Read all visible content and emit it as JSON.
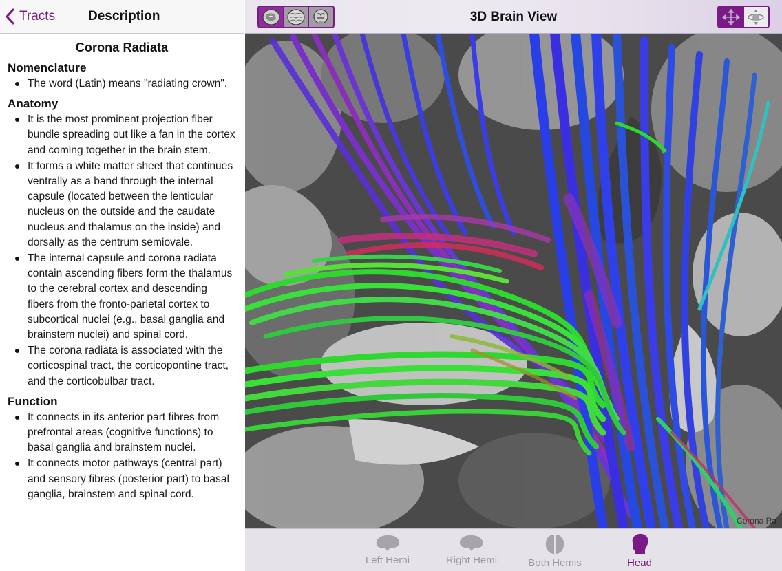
{
  "left_nav": {
    "back_label": "Tracts",
    "title": "Description"
  },
  "description": {
    "title": "Corona Radiata",
    "sections": [
      {
        "heading": "Nomenclature",
        "items": [
          "The word (Latin) means \"radiating crown\"."
        ]
      },
      {
        "heading": "Anatomy",
        "items": [
          "It is the most prominent projection fiber bundle spreading out like a fan in the cortex and coming together in the brain stem.",
          "It forms a white matter sheet that continues ventrally as a band through the internal capsule (located between the lenticular nucleus on the outside and the caudate nucleus and thalamus on the inside) and dorsally as the centrum semiovale.",
          "The internal capsule and corona radiata contain ascending fibers form the thalamus to the cerebral cortex and descending fibers from the fronto-parietal cortex to subcortical nuclei (e.g., basal ganglia and brainstem nuclei) and spinal cord.",
          "The corona radiata is associated with the corticospinal tract, the corticopontine tract, and the corticobulbar tract."
        ]
      },
      {
        "heading": "Function",
        "items": [
          "It connects in its anterior part fibres from prefrontal areas (cognitive functions) to basal ganglia and brainstem nuclei.",
          "It connects motor pathways (central part) and sensory fibres (posterior part) to basal ganglia, brainstem and spinal cord."
        ]
      }
    ]
  },
  "right_nav": {
    "title": "3D Brain View",
    "view_icons": [
      "sagittal-slice-icon",
      "axial-slice-icon",
      "coronal-slice-icon"
    ],
    "tool_icons": [
      "move-arrows-icon",
      "rotate-icon"
    ]
  },
  "viewport": {
    "corner_label": "Corona Ra"
  },
  "tabs": [
    {
      "label": "Left Hemi",
      "icon": "left-hemisphere-icon",
      "active": false
    },
    {
      "label": "Right Hemi",
      "icon": "right-hemisphere-icon",
      "active": false
    },
    {
      "label": "Both Hemis",
      "icon": "both-hemispheres-icon",
      "active": false
    },
    {
      "label": "Head",
      "icon": "head-icon",
      "active": true
    }
  ],
  "colors": {
    "accent": "#7a1a86",
    "tab_inactive": "#9b98a0"
  }
}
